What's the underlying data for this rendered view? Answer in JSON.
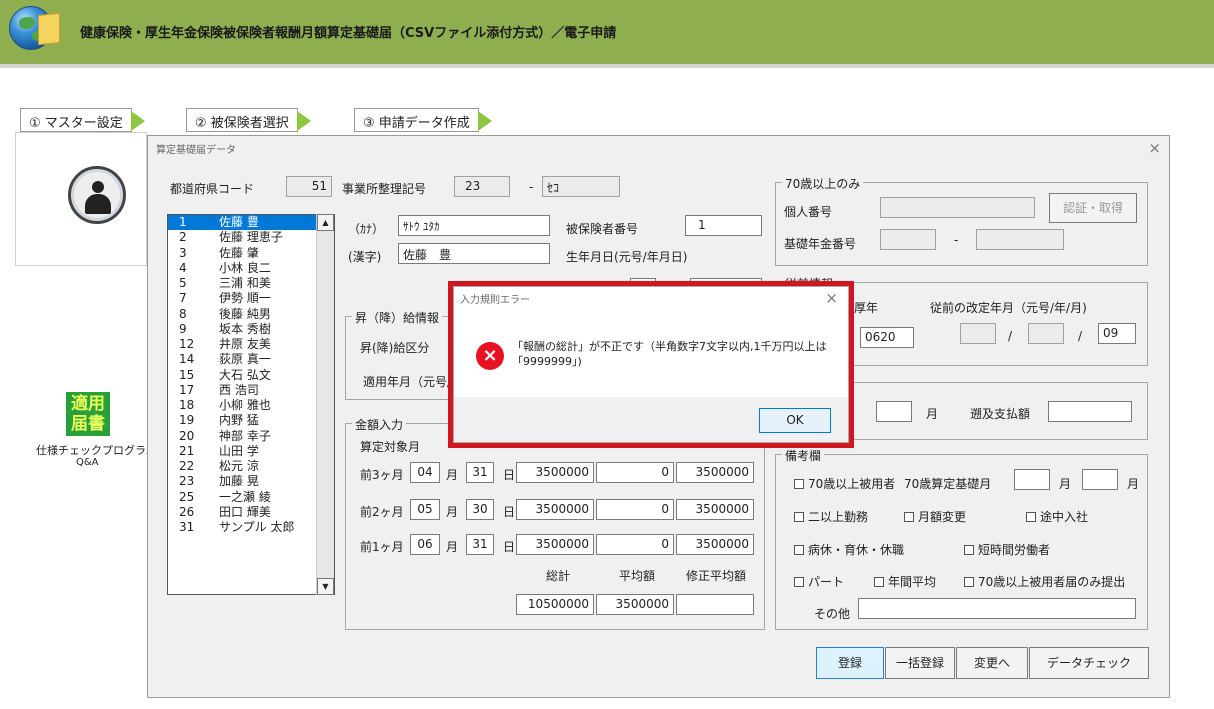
{
  "header": {
    "title": "健康保険・厚生年金保険被保険者報酬月額算定基礎届（CSVファイル添付方式）／電子申請"
  },
  "steps": [
    {
      "label": "① マスター設定"
    },
    {
      "label": "② 被保険者選択"
    },
    {
      "label": "③ 申請データ作成"
    }
  ],
  "side": {
    "apply_icon_text": "適用届書",
    "label1": "仕様チェックプログラム",
    "label2": "Q&A"
  },
  "window": {
    "title": "算定基礎届データ",
    "close": "×",
    "pref_code_label": "都道府県コード",
    "pref_code": "51",
    "office_no_label": "事業所整理記号",
    "office_no_1": "23",
    "office_no_dash": "-",
    "office_no_2": "ｾｺ",
    "kana_label": "（ｶﾅ）",
    "kana_value": "ｻﾄｳ ﾕﾀｶ",
    "kanji_label": "(漢字)",
    "kanji_value": "佐藤　豊",
    "insured_no_label": "被保険者番号",
    "insured_no": "1",
    "birth_label": "生年月日(元号/年月日)",
    "list_items": [
      {
        "num": "1",
        "name": "佐藤 豊"
      },
      {
        "num": "2",
        "name": "佐藤 理恵子"
      },
      {
        "num": "3",
        "name": "佐藤 肇"
      },
      {
        "num": "4",
        "name": "小林 良二"
      },
      {
        "num": "5",
        "name": "三浦 和美"
      },
      {
        "num": "7",
        "name": "伊勢 順一"
      },
      {
        "num": "8",
        "name": "後藤 純男"
      },
      {
        "num": "9",
        "name": "坂本 秀樹"
      },
      {
        "num": "12",
        "name": "井原 友美"
      },
      {
        "num": "14",
        "name": "荻原 真一"
      },
      {
        "num": "15",
        "name": "大石 弘文"
      },
      {
        "num": "17",
        "name": "西 浩司"
      },
      {
        "num": "18",
        "name": "小柳 雅也"
      },
      {
        "num": "19",
        "name": "内野 猛"
      },
      {
        "num": "20",
        "name": "神部 幸子"
      },
      {
        "num": "21",
        "name": "山田 学"
      },
      {
        "num": "22",
        "name": "松元 涼"
      },
      {
        "num": "23",
        "name": "加藤 晃"
      },
      {
        "num": "25",
        "name": "一之瀬 綾"
      },
      {
        "num": "26",
        "name": "田口 輝美"
      },
      {
        "num": "31",
        "name": "サンプル 太郎"
      }
    ],
    "raise_group": "昇（降）給情報",
    "raise_type_label": "昇(降)給区分",
    "apply_ym_label": "適用年月（元号/",
    "amount_group": "金額入力",
    "target_month_label": "算定対象月",
    "month_rows": [
      {
        "label": "前3ヶ月",
        "month": "04",
        "month_unit": "月",
        "days": "31",
        "day_unit": "日",
        "cash": "3500000",
        "goods": "0",
        "total": "3500000"
      },
      {
        "label": "前2ヶ月",
        "month": "05",
        "month_unit": "月",
        "days": "30",
        "day_unit": "日",
        "cash": "3500000",
        "goods": "0",
        "total": "3500000"
      },
      {
        "label": "前1ヶ月",
        "month": "06",
        "month_unit": "月",
        "days": "31",
        "day_unit": "日",
        "cash": "3500000",
        "goods": "0",
        "total": "3500000"
      }
    ],
    "sum_label": "総計",
    "avg_label": "平均額",
    "adj_avg_label": "修正平均額",
    "sum_value": "10500000",
    "avg_value": "3500000",
    "adj_avg_value": "",
    "over70_group": "70歳以上のみ",
    "my_number_label": "個人番号",
    "auth_button": "認証・取得",
    "pension_no_label": "基礎年金番号",
    "pension_dash": "-",
    "prev_group": "従前情報",
    "prev_pension_label": "厚年",
    "prev_rev_label": "従前の改定年月（元号/年/月)",
    "prev_pension_value": "0620",
    "prev_rev_sep1": "/",
    "prev_rev_sep2": "/",
    "prev_rev_month": "09",
    "retro_month_unit": "月",
    "retro_pay_label": "遡及支払額",
    "remarks_group": "備考欄",
    "chk_over70": "70歳以上被用者",
    "over70_base_label": "70歳算定基礎月",
    "month_unit": "月",
    "chk_multi": "二以上勤務",
    "chk_monthly_change": "月額変更",
    "chk_midjoin": "途中入社",
    "chk_leave": "病休・育休・休職",
    "chk_short": "短時間労働者",
    "chk_part": "パート",
    "chk_annual_avg": "年間平均",
    "chk_over70_only": "70歳以上被用者届のみ提出",
    "other_label": "その他",
    "btn_register": "登録",
    "btn_bulk_register": "一括登録",
    "btn_change": "変更へ",
    "btn_datacheck": "データチェック"
  },
  "dialog": {
    "title": "入力規則エラー",
    "close": "×",
    "icon": "×",
    "message": "「報酬の総計」が不正です（半角数字7文字以内,1千万円以上は「9999999」)",
    "ok": "OK"
  }
}
